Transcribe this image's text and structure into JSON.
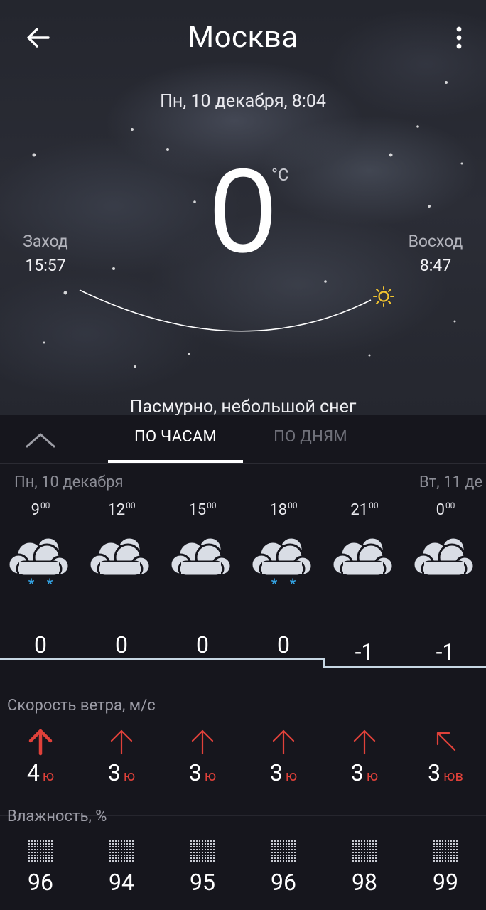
{
  "header": {
    "city": "Москва",
    "datetime": "Пн, 10 декабря, 8:04",
    "temperature": "0",
    "unit": "°C",
    "sunset_label": "Заход",
    "sunset_time": "15:57",
    "sunrise_label": "Восход",
    "sunrise_time": "8:47",
    "condition": "Пасмурно, небольшой снег",
    "sun_icon": "sun-icon"
  },
  "tabs": {
    "hours": "ПО ЧАСАМ",
    "days": "ПО ДНЯМ",
    "active": "hours"
  },
  "forecast": {
    "day1_label": "Пн, 10 декабря",
    "day2_label": "Вт, 11 де",
    "hours": [
      {
        "hour": "9",
        "min": "00",
        "icon": "cloud-snow-icon",
        "temp": "0"
      },
      {
        "hour": "12",
        "min": "00",
        "icon": "cloud-icon",
        "temp": "0"
      },
      {
        "hour": "15",
        "min": "00",
        "icon": "cloud-icon",
        "temp": "0"
      },
      {
        "hour": "18",
        "min": "00",
        "icon": "cloud-snow-icon",
        "temp": "0"
      },
      {
        "hour": "21",
        "min": "00",
        "icon": "cloud-icon",
        "temp": "-1"
      },
      {
        "hour": "0",
        "min": "00",
        "icon": "cloud-icon",
        "temp": "-1"
      }
    ]
  },
  "wind": {
    "title": "Скорость ветра, м/с",
    "accent_color": "#e0413a",
    "items": [
      {
        "speed": "4",
        "dir": "ю"
      },
      {
        "speed": "3",
        "dir": "ю"
      },
      {
        "speed": "3",
        "dir": "ю"
      },
      {
        "speed": "3",
        "dir": "ю"
      },
      {
        "speed": "3",
        "dir": "ю"
      },
      {
        "speed": "3",
        "dir": "юв"
      }
    ]
  },
  "humidity": {
    "title": "Влажность, %",
    "values": [
      "96",
      "94",
      "95",
      "96",
      "98",
      "99"
    ]
  }
}
